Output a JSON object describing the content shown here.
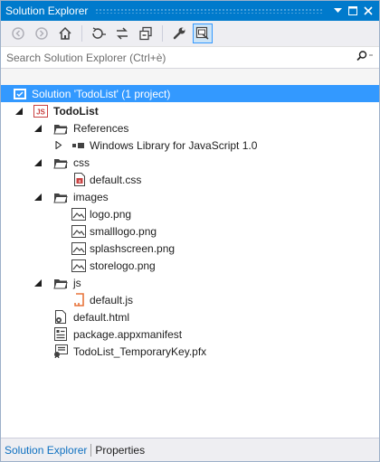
{
  "window": {
    "title": "Solution Explorer"
  },
  "search": {
    "placeholder": "Search Solution Explorer (Ctrl+è)"
  },
  "tree": {
    "solution": "Solution 'TodoList' (1 project)",
    "project": "TodoList",
    "project_badge": "JS",
    "references": "References",
    "winjs": "Windows Library for JavaScript 1.0",
    "css": "css",
    "default_css": "default.css",
    "images": "images",
    "logo": "logo.png",
    "smalllogo": "smalllogo.png",
    "splashscreen": "splashscreen.png",
    "storelogo": "storelogo.png",
    "js": "js",
    "default_js": "default.js",
    "default_html": "default.html",
    "manifest": "package.appxmanifest",
    "tempkey": "TodoList_TemporaryKey.pfx"
  },
  "tabs": {
    "solution_explorer": "Solution Explorer",
    "properties": "Properties"
  },
  "colors": {
    "accent": "#007acc",
    "selection": "#3399ff",
    "active_tab": "#0e70c0"
  }
}
